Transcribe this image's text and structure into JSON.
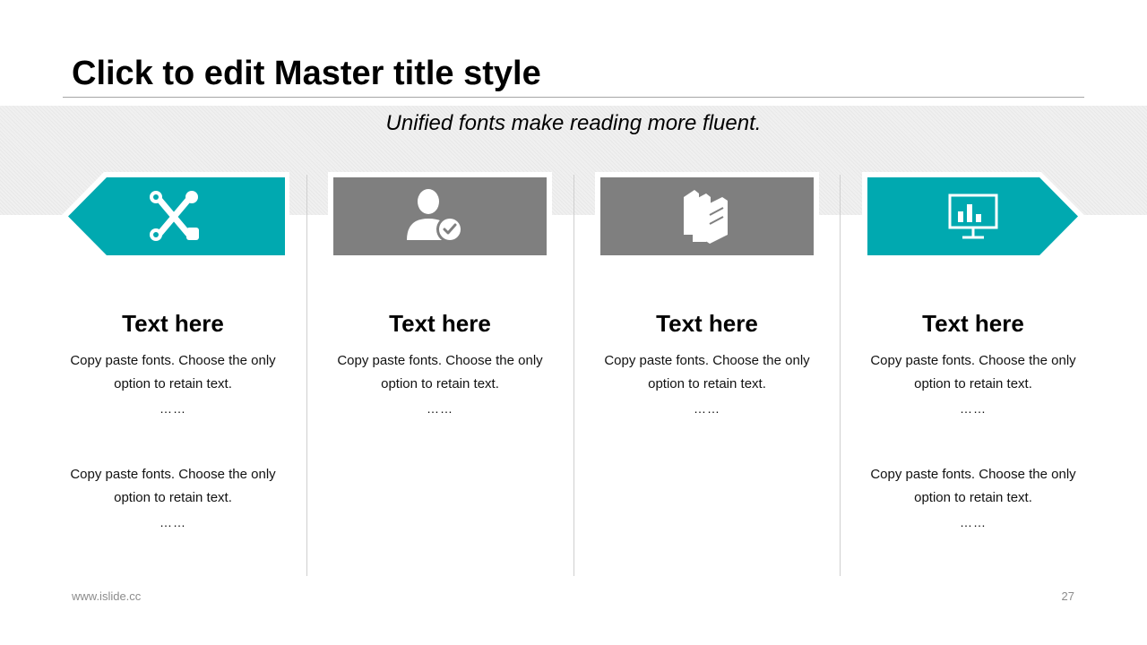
{
  "slide": {
    "title": "Click to edit Master title style",
    "subtitle": "Unified fonts make reading more fluent."
  },
  "colors": {
    "teal": "#00a9b0",
    "gray": "#7f7f7f"
  },
  "columns": [
    {
      "icon": "tools-icon",
      "style": "teal arrow pointing left",
      "title": "Text here",
      "paragraphs": [
        {
          "line1": "Copy paste fonts. Choose the only",
          "line2": "option to retain text.",
          "dots": "……"
        },
        {
          "line1": "Copy paste fonts. Choose the only",
          "line2": "option to retain text.",
          "dots": "……"
        }
      ]
    },
    {
      "icon": "user-check-icon",
      "style": "gray box",
      "title": "Text here",
      "paragraphs": [
        {
          "line1": "Copy paste fonts. Choose the only",
          "line2": "option to retain text.",
          "dots": "……"
        }
      ]
    },
    {
      "icon": "books-icon",
      "style": "gray box",
      "title": "Text here",
      "paragraphs": [
        {
          "line1": "Copy paste fonts. Choose the only",
          "line2": "option to retain text.",
          "dots": "……"
        }
      ]
    },
    {
      "icon": "presentation-chart-icon",
      "style": "teal arrow pointing right",
      "title": "Text here",
      "paragraphs": [
        {
          "line1": "Copy paste fonts. Choose the only",
          "line2": "option to retain text.",
          "dots": "……"
        },
        {
          "line1": "Copy paste fonts. Choose the only",
          "line2": "option to retain text.",
          "dots": "……"
        }
      ]
    }
  ],
  "footer": {
    "url": "www.islide.cc",
    "page_number": "27"
  }
}
